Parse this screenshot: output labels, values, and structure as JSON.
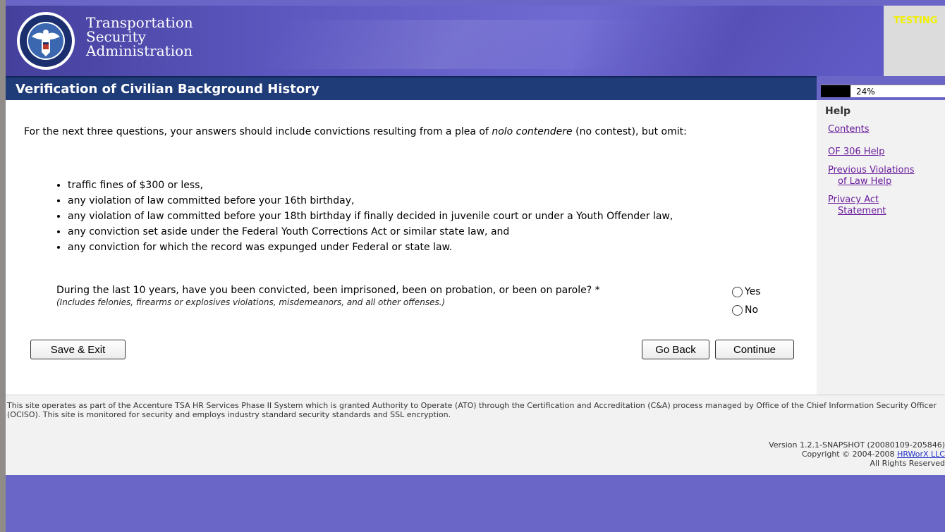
{
  "header": {
    "agency_line1": "Transportation",
    "agency_line2": "Security",
    "agency_line3": "Administration",
    "testing_label": "TESTING"
  },
  "title_bar": {
    "title": "Verification of Civilian Background History"
  },
  "progress": {
    "label": "24%",
    "percent": 24
  },
  "main": {
    "intro_before": "For the next three questions, your answers should include convictions resulting from a plea of ",
    "intro_italic": "nolo contendere",
    "intro_after": " (no contest), but omit:",
    "omit_items": [
      "traffic fines of $300 or less,",
      "any violation of law committed before your 16th birthday,",
      "any violation of law committed before your 18th birthday if finally decided in juvenile court or under a Youth Offender law,",
      "any conviction set aside under the Federal Youth Corrections Act or similar state law, and",
      "any conviction for which the record was expunged under Federal or state law."
    ],
    "question": "During the last 10 years, have you been convicted, been imprisoned, been on probation, or been on parole? *",
    "question_note": "(Includes felonies, firearms or explosives violations, misdemeanors, and all other offenses.)",
    "options": {
      "yes": "Yes",
      "no": "No"
    },
    "buttons": {
      "save_exit": "Save & Exit",
      "go_back": "Go Back",
      "continue": "Continue"
    }
  },
  "help": {
    "heading": "Help",
    "contents": "Contents",
    "of306": "OF 306 Help",
    "prev_violations_1": "Previous Violations",
    "prev_violations_2": "of Law Help",
    "privacy_1": "Privacy Act",
    "privacy_2": "Statement"
  },
  "footer": {
    "notice": "This site operates as part of the Accenture TSA HR Services Phase II System which is granted Authority to Operate (ATO) through the Certification and Accreditation (C&A) process managed by Office of the Chief Information Security Officer (OCISO). This site is monitored for security and employs industry standard security standards and SSL encryption.",
    "version": "Version 1.2.1-SNAPSHOT (20080109-205846)",
    "copyright_prefix": "Copyright © 2004-2008 ",
    "copyright_link": "HRWorX LLC",
    "rights": "All Rights Reserved"
  },
  "colors": {
    "header_bg": "#5d58c0",
    "title_bar_bg": "#1f3c79",
    "testing_text": "#f0f000",
    "link": "#6b1d9c",
    "body_bg": "#6a66c8"
  },
  "icons": {
    "seal": "dhs-seal-icon"
  }
}
